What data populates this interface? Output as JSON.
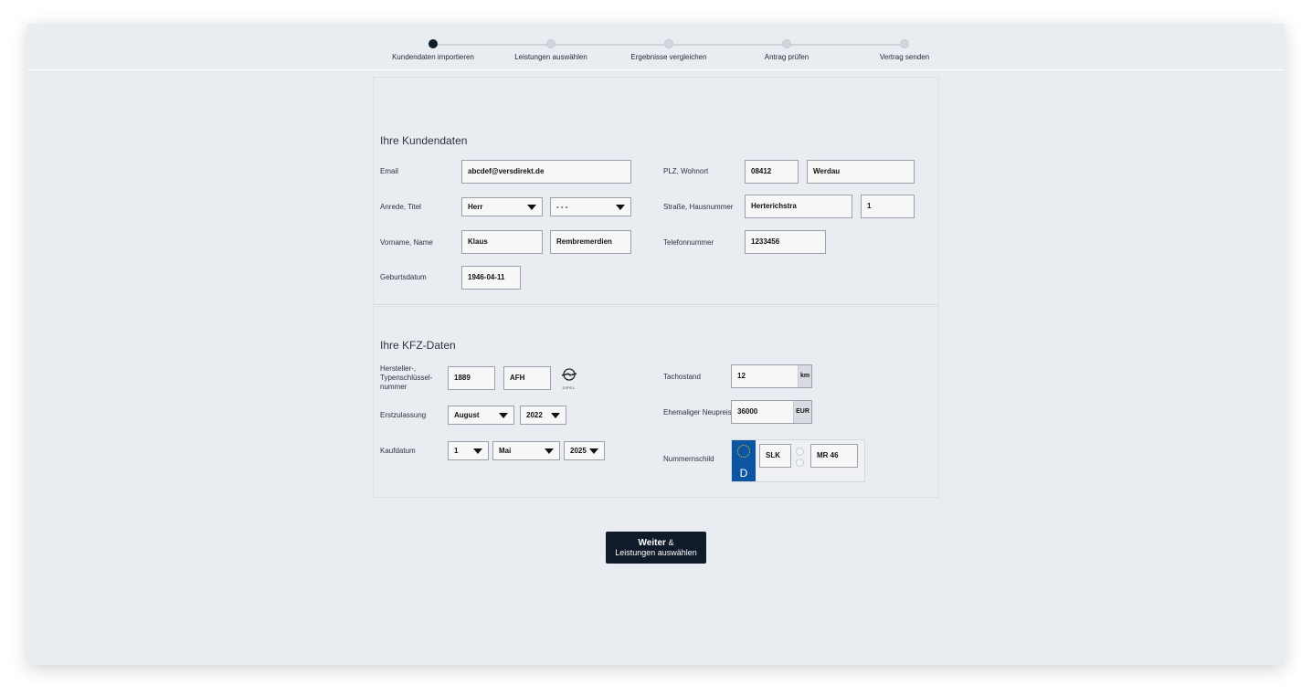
{
  "steps": [
    {
      "label": "Kundendaten importieren",
      "active": true
    },
    {
      "label": "Leistungen auswählen",
      "active": false
    },
    {
      "label": "Ergebnisse vergleichen",
      "active": false
    },
    {
      "label": "Antrag prüfen",
      "active": false
    },
    {
      "label": "Vertrag senden",
      "active": false
    }
  ],
  "customer": {
    "title": "Ihre Kundendaten",
    "email_label": "Email",
    "email": "abcdef@versdirekt.de",
    "salutation_label": "Anrede, Titel",
    "salutation": "Herr",
    "academic_title": "- - -",
    "name_label": "Vorname, Name",
    "first_name": "Klaus",
    "last_name": "Rembremerdien",
    "birthdate_label": "Geburtsdatum",
    "birthdate": "1946-04-11",
    "zip_city_label": "PLZ, Wohnort",
    "zip": "08412",
    "city": "Werdau",
    "street_label": "Straße, Hausnummer",
    "street": "Herterichstra",
    "house_number": "1",
    "phone_label": "Telefonnummer",
    "phone": "1233456"
  },
  "vehicle": {
    "title": "Ihre KFZ-Daten",
    "hsn_label": "Hersteller-, Typenschlüssel-nummer",
    "hsn": "1889",
    "tsn": "AFH",
    "brand_logo": "opel-logo",
    "brand_text": "OPEL",
    "registration_label": "Erstzulassung",
    "registration_month": "August",
    "registration_year": "2022",
    "purchase_label": "Kaufdatum",
    "purchase_day": "1",
    "purchase_month": "Mai",
    "purchase_year": "2025",
    "mileage_label": "Tachostand",
    "mileage": "12",
    "mileage_unit": "km",
    "price_label": "Ehemaliger Neupreis",
    "price": "36000",
    "price_unit": "EUR",
    "plate_label": "Nummernschild",
    "plate_country": "D",
    "plate_district": "SLK",
    "plate_number": "MR 46"
  },
  "button": {
    "primary": "Weiter",
    "ampersand": " &",
    "secondary": "Leistungen auswählen"
  },
  "colors": {
    "background": "#e9ecf1",
    "accent": "#0f1b2a",
    "eu_blue": "#0b55a3"
  }
}
